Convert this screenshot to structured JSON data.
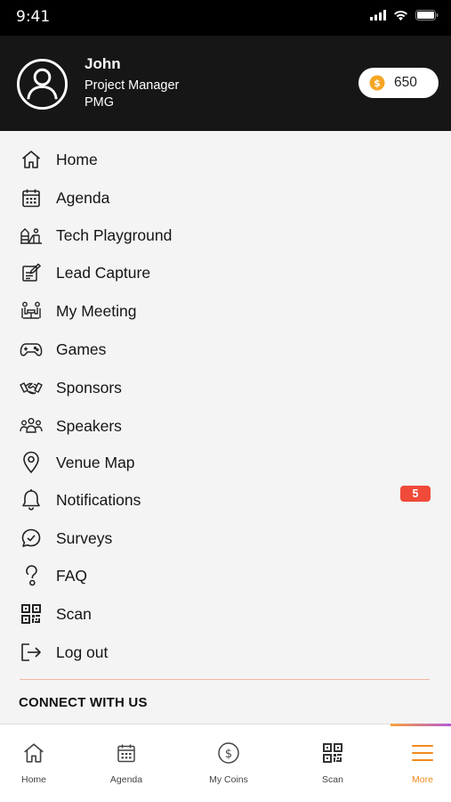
{
  "status_bar": {
    "time": "9:41"
  },
  "profile": {
    "name": "John",
    "role": "Project Manager",
    "organization": "PMG",
    "coins": "650"
  },
  "menu": {
    "items": [
      {
        "label": "Home",
        "icon": "home-icon"
      },
      {
        "label": "Agenda",
        "icon": "calendar-icon"
      },
      {
        "label": "Tech Playground",
        "icon": "playground-icon"
      },
      {
        "label": "Lead Capture",
        "icon": "lead-capture-icon"
      },
      {
        "label": "My Meeting",
        "icon": "meeting-icon"
      },
      {
        "label": "Games",
        "icon": "gamepad-icon"
      },
      {
        "label": "Sponsors",
        "icon": "handshake-icon"
      },
      {
        "label": "Speakers",
        "icon": "people-icon"
      },
      {
        "label": "Venue Map",
        "icon": "location-pin-icon"
      },
      {
        "label": "Notifications",
        "icon": "bell-icon",
        "badge": "5"
      },
      {
        "label": "Surveys",
        "icon": "chat-check-icon"
      },
      {
        "label": "FAQ",
        "icon": "question-icon"
      },
      {
        "label": "Scan",
        "icon": "qr-code-icon"
      },
      {
        "label": "Log out",
        "icon": "logout-icon"
      }
    ],
    "connect_title": "CONNECT WITH US"
  },
  "tabs": [
    {
      "label": "Home",
      "icon": "home-icon",
      "active": false
    },
    {
      "label": "Agenda",
      "icon": "calendar-icon",
      "active": false
    },
    {
      "label": "My Coins",
      "icon": "dollar-coin-icon",
      "active": false
    },
    {
      "label": "Scan",
      "icon": "qr-code-icon",
      "active": false
    },
    {
      "label": "More",
      "icon": "hamburger-icon",
      "active": true
    }
  ],
  "colors": {
    "header_bg": "#161616",
    "coin_gold": "#f5a623",
    "badge_red": "#f04a3a",
    "active_tab": "#f08a1c"
  }
}
